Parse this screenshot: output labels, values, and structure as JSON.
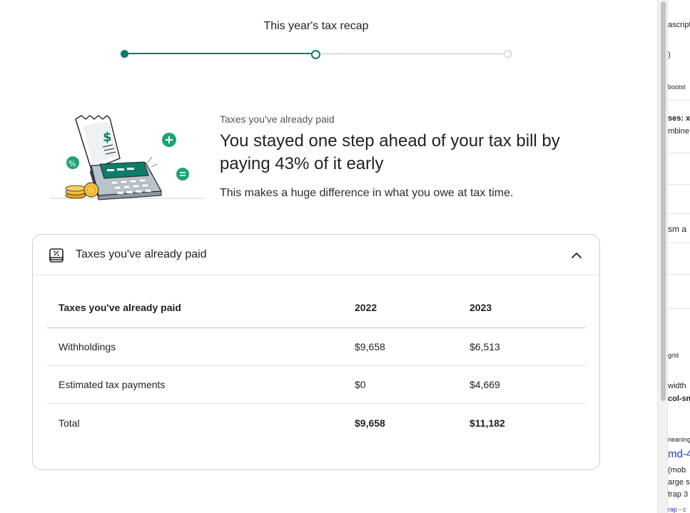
{
  "progress": {
    "title": "This year's tax recap",
    "current_step": 2,
    "total_steps": 3
  },
  "hero": {
    "eyebrow": "Taxes you've already paid",
    "headline": "You stayed one step ahead of your tax bill by paying 43% of it early",
    "subtext": "This makes a huge difference in what you owe at tax time.",
    "illustration_icon": "receipt-calculator-coins-illustration"
  },
  "card": {
    "title": "Taxes you've already paid",
    "icon": "tax-document-icon",
    "toggle_icon": "chevron-up-icon",
    "table": {
      "columns": [
        "Taxes you've already paid",
        "2022",
        "2023"
      ],
      "rows": [
        [
          "Withholdings",
          "$9,658",
          "$6,513"
        ],
        [
          "Estimated tax payments",
          "$0",
          "$4,669"
        ],
        [
          "Total",
          "$9,658",
          "$11,182"
        ]
      ]
    }
  },
  "side_panel": {
    "fragments": [
      "ascript",
      ")",
      "bootst",
      "ses: xs",
      "mbine",
      "sm a",
      "grid",
      "width",
      "col-sm",
      "neaning",
      "md-4",
      "(mob",
      "arge s",
      "trap 3",
      "rap - c"
    ]
  },
  "colors": {
    "accent": "#0e7c6b",
    "text": "#1f2126",
    "muted": "#50575f",
    "border": "#c9ced4"
  }
}
